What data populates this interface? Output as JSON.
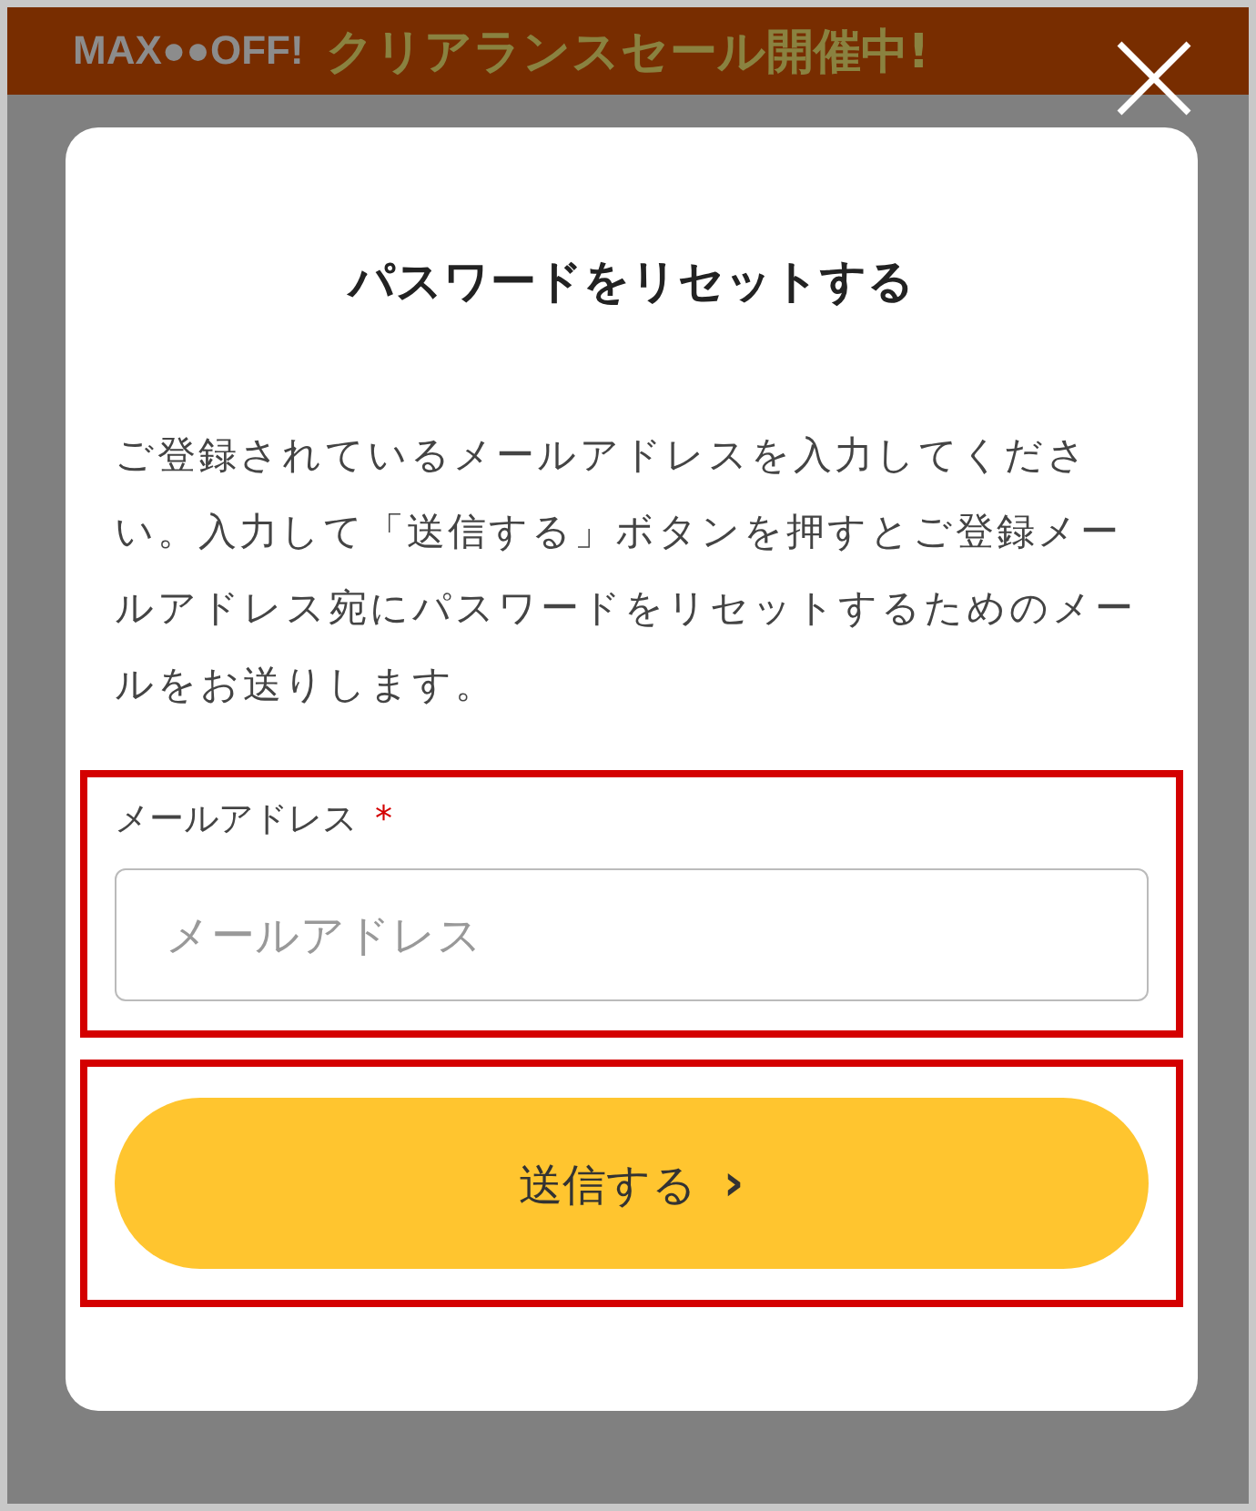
{
  "banner": {
    "prefix": "MAX●●OFF!",
    "headline": "クリアランスセール開催中!"
  },
  "modal": {
    "title": "パスワードをリセットする",
    "description": "ご登録されているメールアドレスを入力してください。入力して「送信する」ボタンを押すとご登録メールアドレス宛にパスワードをリセットするためのメールをお送りします。",
    "email_field": {
      "label": "メールアドレス",
      "required_mark": "*",
      "placeholder": "メールアドレス",
      "highlighted": true
    },
    "submit_button": {
      "label": "送信する",
      "icon": "›",
      "highlighted": true
    }
  }
}
